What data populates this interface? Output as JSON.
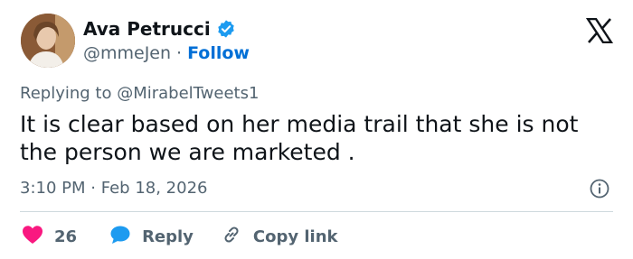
{
  "author": {
    "name": "Ava Petrucci",
    "handle": "@mmeJen",
    "follow_label": "Follow",
    "separator": "·",
    "verified_icon": "verified-badge-icon",
    "avatar_icon": "avatar"
  },
  "brand": {
    "logo": "x-logo-icon"
  },
  "reply": {
    "prefix": "Replying to ",
    "target": "@MirabelTweets1"
  },
  "tweet": {
    "text": "It is clear based on her media trail that she is not the person we are marketed ."
  },
  "meta": {
    "time": "3:10 PM",
    "separator": "·",
    "date": "Feb 18, 2026",
    "info_icon": "info-icon"
  },
  "actions": {
    "like_count": "26",
    "reply_label": "Reply",
    "copy_label": "Copy link"
  },
  "colors": {
    "accent": "#1d9bf0",
    "link": "#006fd6",
    "heart": "#f91880",
    "text": "#0f1419",
    "muted": "#536471",
    "divider": "#cfd9de"
  }
}
